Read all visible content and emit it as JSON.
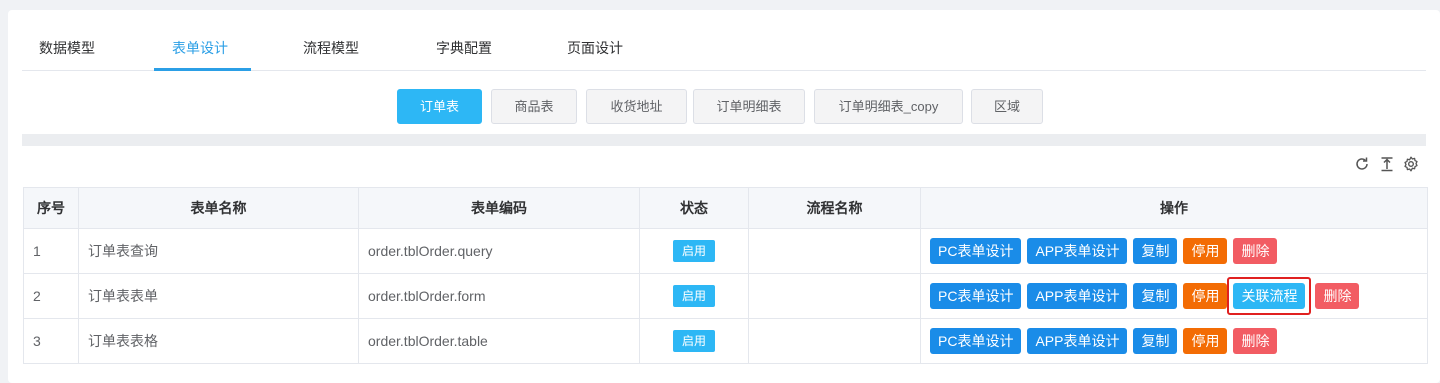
{
  "tabs": [
    {
      "label": "数据模型"
    },
    {
      "label": "表单设计"
    },
    {
      "label": "流程模型"
    },
    {
      "label": "字典配置"
    },
    {
      "label": "页面设计"
    }
  ],
  "active_tab": "表单设计",
  "subtabs": [
    {
      "label": "订单表"
    },
    {
      "label": "商品表"
    },
    {
      "label": "收货地址"
    },
    {
      "label": "订单明细表"
    },
    {
      "label": "订单明细表_copy"
    },
    {
      "label": "区域"
    }
  ],
  "active_subtab": "订单表",
  "toolbar_icons": [
    "refresh-icon",
    "export-icon",
    "settings-icon"
  ],
  "table": {
    "headers": {
      "index": "序号",
      "name": "表单名称",
      "code": "表单编码",
      "status": "状态",
      "flow": "流程名称",
      "actions": "操作"
    },
    "rows": [
      {
        "index": "1",
        "name": "订单表查询",
        "code": "order.tblOrder.query",
        "status": "启用",
        "flow": ""
      },
      {
        "index": "2",
        "name": "订单表表单",
        "code": "order.tblOrder.form",
        "status": "启用",
        "flow": ""
      },
      {
        "index": "3",
        "name": "订单表表格",
        "code": "order.tblOrder.table",
        "status": "启用",
        "flow": ""
      }
    ],
    "actions": {
      "pc_design": "PC表单设计",
      "app_design": "APP表单设计",
      "copy": "复制",
      "disable": "停用",
      "link_flow": "关联流程",
      "delete": "删除"
    }
  },
  "colors": {
    "primary": "#2b9fe6",
    "button_blue": "#1a8ce8",
    "button_light_blue": "#2db7f5",
    "button_orange": "#f36c04",
    "button_red": "#f25c63",
    "highlight_border": "#e02020"
  }
}
